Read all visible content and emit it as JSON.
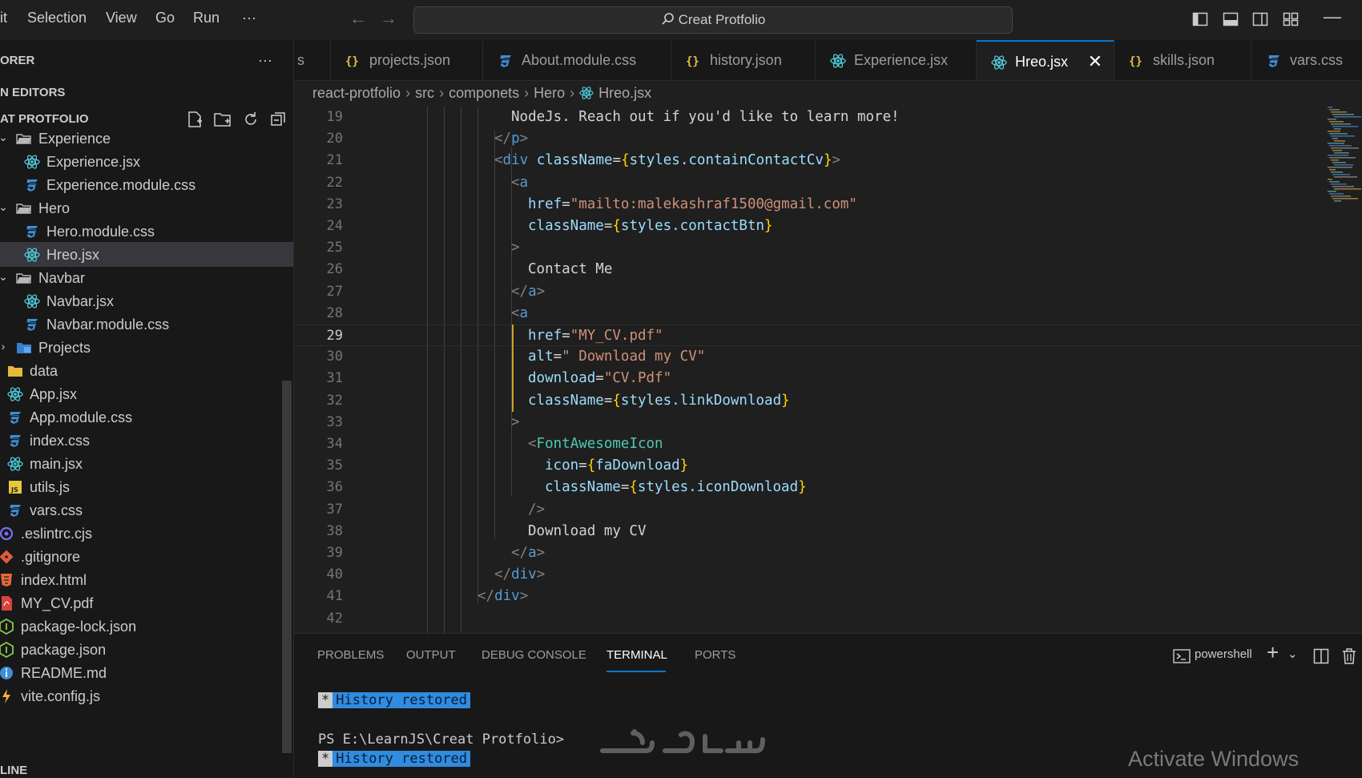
{
  "menu": {
    "items": [
      "it",
      "Selection",
      "View",
      "Go",
      "Run",
      "···"
    ]
  },
  "command_center": {
    "query": "Creat Protfolio"
  },
  "sidebar": {
    "explorer_title": "ORER",
    "explorer_more": "···",
    "open_editors": "N EDITORS",
    "project_title": "AT PROTFOLIO",
    "tree": [
      {
        "label": "Experience",
        "kind": "folder-open",
        "chev": "⌄",
        "depth": 0
      },
      {
        "label": "Experience.jsx",
        "kind": "react",
        "depth": 1
      },
      {
        "label": "Experience.module.css",
        "kind": "css",
        "depth": 1
      },
      {
        "label": "Hero",
        "kind": "folder-open",
        "chev": "⌄",
        "depth": 0
      },
      {
        "label": "Hero.module.css",
        "kind": "css",
        "depth": 1
      },
      {
        "label": "Hreo.jsx",
        "kind": "react",
        "depth": 1,
        "selected": true
      },
      {
        "label": "Navbar",
        "kind": "folder-open",
        "chev": "⌄",
        "depth": 0
      },
      {
        "label": "Navbar.jsx",
        "kind": "react",
        "depth": 1
      },
      {
        "label": "Navbar.module.css",
        "kind": "css",
        "depth": 1
      },
      {
        "label": "Projects",
        "kind": "folder-blue",
        "chev": "›",
        "depth": 0
      },
      {
        "label": "data",
        "kind": "folder-yellow",
        "depth": -1
      },
      {
        "label": "App.jsx",
        "kind": "react",
        "depth": -1
      },
      {
        "label": "App.module.css",
        "kind": "css",
        "depth": -1
      },
      {
        "label": "index.css",
        "kind": "css",
        "depth": -1
      },
      {
        "label": "main.jsx",
        "kind": "react",
        "depth": -1
      },
      {
        "label": "utils.js",
        "kind": "js",
        "depth": -1
      },
      {
        "label": "vars.css",
        "kind": "css",
        "depth": -1
      },
      {
        "label": ".eslintrc.cjs",
        "kind": "eslint",
        "depth": -2
      },
      {
        "label": ".gitignore",
        "kind": "git",
        "depth": -2
      },
      {
        "label": "index.html",
        "kind": "html",
        "depth": -2
      },
      {
        "label": "MY_CV.pdf",
        "kind": "pdf",
        "depth": -2
      },
      {
        "label": "package-lock.json",
        "kind": "npm",
        "depth": -2
      },
      {
        "label": "package.json",
        "kind": "npm",
        "depth": -2
      },
      {
        "label": "README.md",
        "kind": "info",
        "depth": -2
      },
      {
        "label": "vite.config.js",
        "kind": "vite",
        "depth": -2
      }
    ],
    "outline": "LINE"
  },
  "tabs": [
    {
      "label": "s",
      "kind": "none"
    },
    {
      "label": "projects.json",
      "kind": "json"
    },
    {
      "label": "About.module.css",
      "kind": "css"
    },
    {
      "label": "history.json",
      "kind": "json"
    },
    {
      "label": "Experience.jsx",
      "kind": "react"
    },
    {
      "label": "Hreo.jsx",
      "kind": "react",
      "active": true
    },
    {
      "label": "skills.json",
      "kind": "json"
    },
    {
      "label": "vars.css",
      "kind": "css"
    }
  ],
  "breadcrumb": [
    "react-protfolio",
    "src",
    "componets",
    "Hero",
    "Hreo.jsx"
  ],
  "editor": {
    "current_line": 29,
    "lines": [
      {
        "n": "19",
        "indent": 9,
        "tokens": [
          [
            "t-txt",
            "NodeJs. Reach out if you'd like to learn more!"
          ]
        ]
      },
      {
        "n": "20",
        "indent": 8,
        "tokens": [
          [
            "t-tag",
            "</"
          ],
          [
            "t-el",
            "p"
          ],
          [
            "t-tag",
            ">"
          ]
        ]
      },
      {
        "n": "21",
        "indent": 8,
        "tokens": [
          [
            "t-tag",
            "<"
          ],
          [
            "t-el",
            "div"
          ],
          [
            "t-txt",
            " "
          ],
          [
            "t-attr",
            "className"
          ],
          [
            "t-eq",
            "="
          ],
          [
            "t-br",
            "{"
          ],
          [
            "t-attr",
            "styles.containContactCv"
          ],
          [
            "t-br",
            "}"
          ],
          [
            "t-tag",
            ">"
          ]
        ]
      },
      {
        "n": "22",
        "indent": 9,
        "tokens": [
          [
            "t-tag",
            "<"
          ],
          [
            "t-el",
            "a"
          ]
        ]
      },
      {
        "n": "23",
        "indent": 10,
        "tokens": [
          [
            "t-attr",
            "href"
          ],
          [
            "t-eq",
            "="
          ],
          [
            "t-str",
            "\"mailto:malekashraf1500@gmail.com\""
          ]
        ]
      },
      {
        "n": "24",
        "indent": 10,
        "tokens": [
          [
            "t-attr",
            "className"
          ],
          [
            "t-eq",
            "="
          ],
          [
            "t-br",
            "{"
          ],
          [
            "t-attr",
            "styles.contactBtn"
          ],
          [
            "t-br",
            "}"
          ]
        ]
      },
      {
        "n": "25",
        "indent": 9,
        "tokens": [
          [
            "t-tag",
            ">"
          ]
        ]
      },
      {
        "n": "26",
        "indent": 10,
        "tokens": [
          [
            "t-txt",
            "Contact Me"
          ]
        ]
      },
      {
        "n": "27",
        "indent": 9,
        "tokens": [
          [
            "t-tag",
            "</"
          ],
          [
            "t-el",
            "a"
          ],
          [
            "t-tag",
            ">"
          ]
        ]
      },
      {
        "n": "28",
        "indent": 9,
        "tokens": [
          [
            "t-tag",
            "<"
          ],
          [
            "t-el",
            "a"
          ]
        ]
      },
      {
        "n": "29",
        "indent": 10,
        "tokens": [
          [
            "t-attr",
            "href"
          ],
          [
            "t-eq",
            "="
          ],
          [
            "t-str",
            "\"MY_CV.pdf\""
          ]
        ]
      },
      {
        "n": "30",
        "indent": 10,
        "tokens": [
          [
            "t-attr",
            "alt"
          ],
          [
            "t-eq",
            "="
          ],
          [
            "t-str",
            "\" Download my CV\""
          ]
        ]
      },
      {
        "n": "31",
        "indent": 10,
        "tokens": [
          [
            "t-attr",
            "download"
          ],
          [
            "t-eq",
            "="
          ],
          [
            "t-str",
            "\"CV.Pdf\""
          ]
        ]
      },
      {
        "n": "32",
        "indent": 10,
        "tokens": [
          [
            "t-attr",
            "className"
          ],
          [
            "t-eq",
            "="
          ],
          [
            "t-br",
            "{"
          ],
          [
            "t-attr",
            "styles.linkDownload"
          ],
          [
            "t-br",
            "}"
          ]
        ]
      },
      {
        "n": "33",
        "indent": 9,
        "tokens": [
          [
            "t-tag",
            ">"
          ]
        ]
      },
      {
        "n": "34",
        "indent": 10,
        "tokens": [
          [
            "t-tag",
            "<"
          ],
          [
            "t-comp",
            "FontAwesomeIcon"
          ]
        ]
      },
      {
        "n": "35",
        "indent": 11,
        "tokens": [
          [
            "t-attr",
            "icon"
          ],
          [
            "t-eq",
            "="
          ],
          [
            "t-br",
            "{"
          ],
          [
            "t-attr",
            "faDownload"
          ],
          [
            "t-br",
            "}"
          ]
        ]
      },
      {
        "n": "36",
        "indent": 11,
        "tokens": [
          [
            "t-attr",
            "className"
          ],
          [
            "t-eq",
            "="
          ],
          [
            "t-br",
            "{"
          ],
          [
            "t-attr",
            "styles.iconDownload"
          ],
          [
            "t-br",
            "}"
          ]
        ]
      },
      {
        "n": "37",
        "indent": 10,
        "tokens": [
          [
            "t-tag",
            "/>"
          ]
        ]
      },
      {
        "n": "38",
        "indent": 10,
        "tokens": [
          [
            "t-txt",
            "Download my CV"
          ]
        ]
      },
      {
        "n": "39",
        "indent": 9,
        "tokens": [
          [
            "t-tag",
            "</"
          ],
          [
            "t-el",
            "a"
          ],
          [
            "t-tag",
            ">"
          ]
        ]
      },
      {
        "n": "40",
        "indent": 8,
        "tokens": [
          [
            "t-tag",
            "</"
          ],
          [
            "t-el",
            "div"
          ],
          [
            "t-tag",
            ">"
          ]
        ]
      },
      {
        "n": "41",
        "indent": 7,
        "tokens": [
          [
            "t-tag",
            "</"
          ],
          [
            "t-el",
            "div"
          ],
          [
            "t-tag",
            ">"
          ]
        ]
      },
      {
        "n": "42",
        "indent": 0,
        "tokens": []
      }
    ]
  },
  "panel": {
    "tabs": [
      "PROBLEMS",
      "OUTPUT",
      "DEBUG CONSOLE",
      "TERMINAL",
      "PORTS"
    ],
    "active_tab": "TERMINAL",
    "shell": "powershell",
    "terminal": {
      "star": "*",
      "restored": "History restored",
      "prompt": "PS E:\\LearnJS\\Creat Protfolio>"
    }
  },
  "watermark": {
    "logo_text": "خمسات",
    "activate": "Activate Windows"
  },
  "colors": {
    "accent": "#0078d4",
    "react": "#4ec9d9",
    "css": "#3d8fd6",
    "json": "#e2c04a",
    "guide_active": "#c9a227"
  }
}
